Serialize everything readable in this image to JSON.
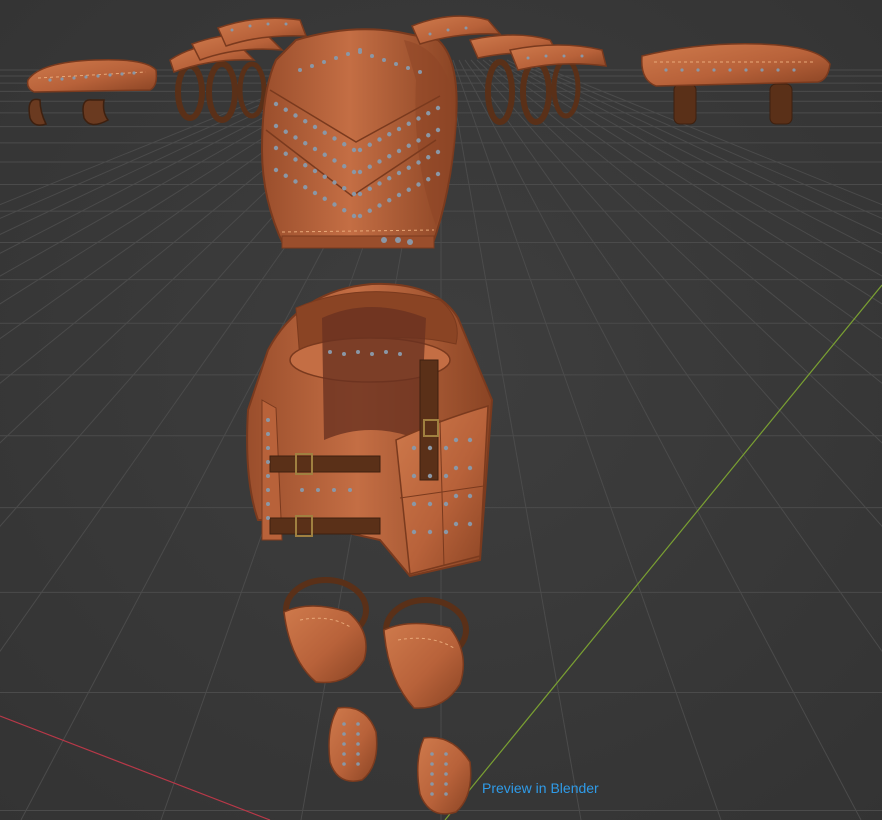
{
  "viewport": {
    "caption": "Preview in Blender",
    "caption_color": "#2f9be8",
    "background_color": "#3a3a3a",
    "grid_color": "#4b4b4b",
    "x_axis_color": "#b83848",
    "y_axis_color": "#7aa032"
  },
  "model": {
    "leather_color": "#b8623a",
    "leather_shadow": "#7a3a1e",
    "leather_highlight": "#d98a5e",
    "strap_color": "#5a3018",
    "rivet_color": "#8a97a6",
    "parts": [
      "left-bracer",
      "left-pauldron",
      "breastplate",
      "right-pauldron",
      "right-bracer",
      "back-armor",
      "left-greave",
      "right-greave",
      "left-knee-guard",
      "right-knee-guard"
    ]
  }
}
